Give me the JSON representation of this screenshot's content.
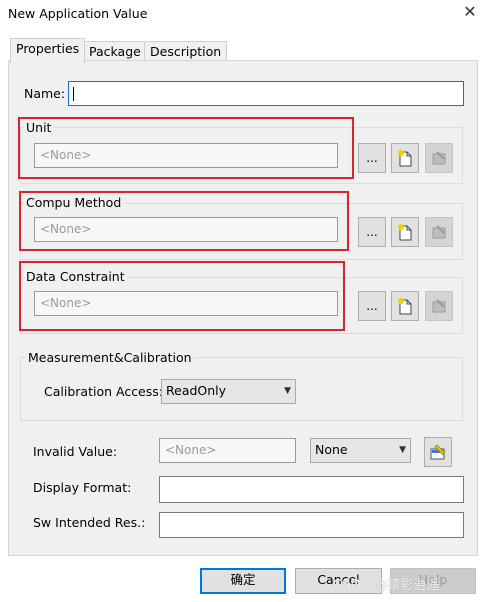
{
  "window": {
    "title": "New Application Value",
    "close_glyph": "✕"
  },
  "tabs": [
    {
      "label": "Properties",
      "active": true
    },
    {
      "label": "Package",
      "active": false
    },
    {
      "label": "Description",
      "active": false
    }
  ],
  "name_field": {
    "label": "Name:",
    "value": ""
  },
  "unit": {
    "label": "Unit",
    "value": "<None>",
    "browse_label": "..."
  },
  "compu_method": {
    "label": "Compu Method",
    "value": "<None>",
    "browse_label": "..."
  },
  "data_constraint": {
    "label": "Data Constraint",
    "value": "<None>",
    "browse_label": "..."
  },
  "measurement": {
    "group_label": "Measurement&Calibration",
    "calibration_access_label": "Calibration Access:",
    "calibration_access_value": "ReadOnly"
  },
  "invalid_value": {
    "label": "Invalid Value:",
    "value": "<None>",
    "combo_value": "None"
  },
  "display_format": {
    "label": "Display Format:",
    "value": ""
  },
  "sw_intended_res": {
    "label": "Sw Intended Res.:",
    "value": ""
  },
  "footer": {
    "ok_label": "确定",
    "cancel_label": "Cancel",
    "help_label": "Help"
  },
  "watermark": "CSDN @猿影逍遥",
  "colors": {
    "highlight_red": "#d9232e",
    "focus_blue": "#0078d7"
  }
}
